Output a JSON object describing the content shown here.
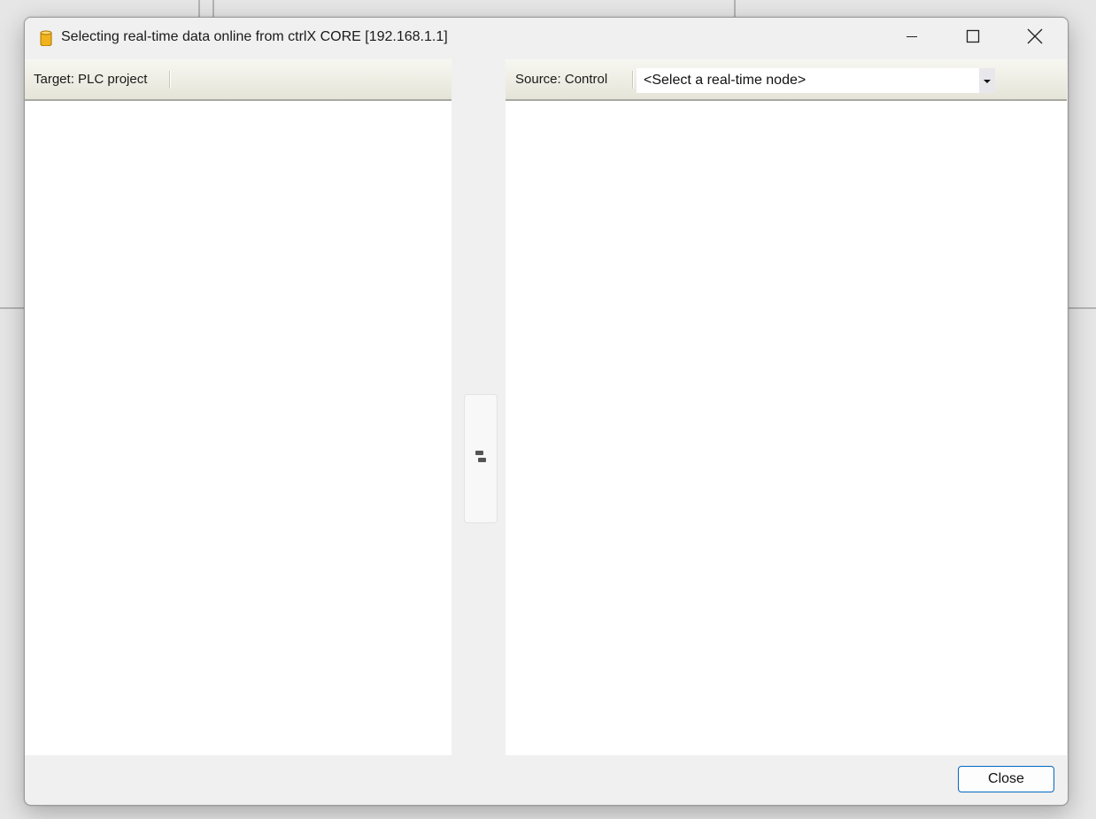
{
  "window": {
    "title": "Selecting real-time data online from ctrlX CORE [192.168.1.1]",
    "icon": "database-icon"
  },
  "left_pane": {
    "header_label": "Target: PLC project"
  },
  "right_pane": {
    "header_label": "Source: Control",
    "node_select_value": "<Select a real-time node>"
  },
  "footer": {
    "close_label": "Close"
  },
  "colors": {
    "accent_border": "#0067c0",
    "icon_fill": "#f2b21b"
  }
}
